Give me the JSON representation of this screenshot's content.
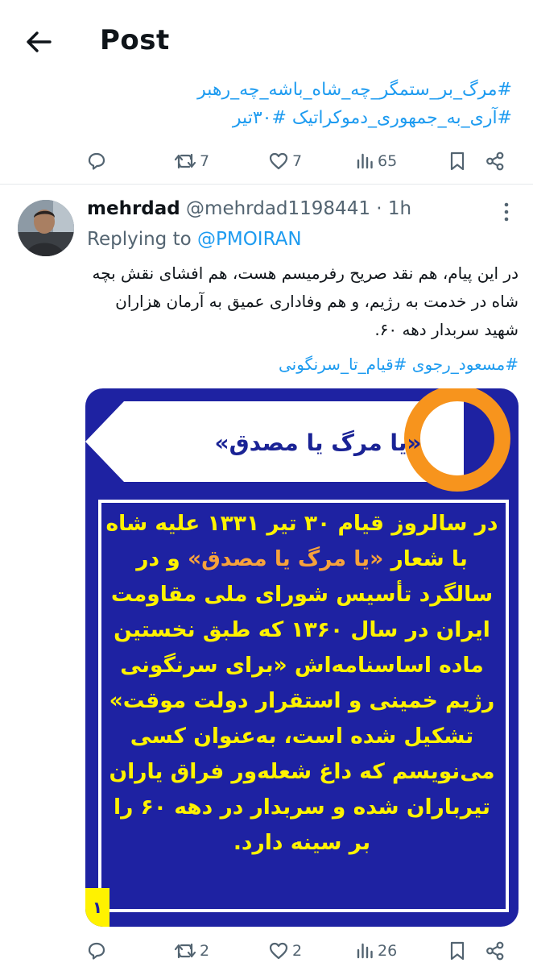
{
  "header": {
    "title": "Post"
  },
  "previous_post": {
    "hashtags_line1": "#مرگ_بر_ستمگر_چه_شاه_باشه_چه_رهبر",
    "hashtags_line2": "#آری_به_جمهوری_دموکراتیک #۳۰تیر",
    "actions": {
      "reposts": "7",
      "likes": "7",
      "views": "65"
    }
  },
  "post": {
    "author_name": "mehrdad",
    "author_handle": "@mehrdad1198441",
    "separator": "·",
    "time": "1h",
    "replying_to_label": "Replying to",
    "replying_to_handle": "@PMOIRAN",
    "text": "در این پیام، هم نقد صریح رفرمیسم هست، هم افشای نقش بچه شاه در خدمت به رژیم، و هم وفاداری عمیق به آرمان هزاران شهید سربدار دهه ۶۰.",
    "hashtags": "#مسعود_رجوی #قیام_تا_سرنگونی",
    "media": {
      "title": "«یا مرگ یا مصدق»",
      "body_part1": "در سالروز قیام ۳۰ تیر ۱۳۳۱ علیه شاه با شعار ",
      "body_highlight": "«یا مرگ یا مصدق»",
      "body_part2": " و در سالگرد تأسیس شورای ملی مقاومت ایران در سال ۱۳۶۰ که طبق نخستین ماده اساسنامه‌اش «برای سرنگونی رژیم خمینی و استقرار دولت موقت» تشکیل شده است، به‌عنوان کسی می‌نویسم که داغ شعله‌ور فراق یاران تیرباران شده و سربدار در دهه ۶۰ را بر سینه دارد.",
      "page_number": "۱",
      "colors": {
        "background": "#1e22a2",
        "text": "#fff200",
        "highlight": "#f7a23b",
        "circle": "#f7941d"
      }
    },
    "actions": {
      "reposts": "2",
      "likes": "2",
      "views": "26"
    }
  },
  "colors": {
    "link": "#1d9bf0",
    "secondary_text": "#536471",
    "primary_text": "#0f1419"
  }
}
